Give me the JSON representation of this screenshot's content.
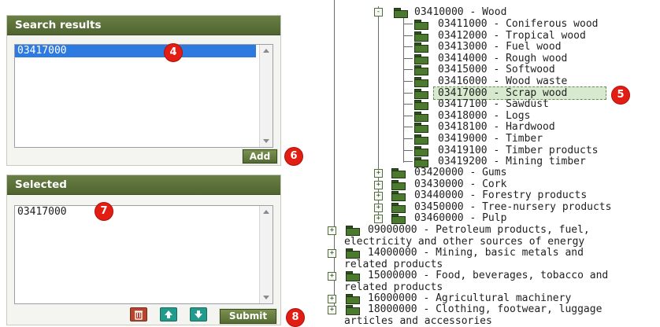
{
  "search_results": {
    "title": "Search results",
    "items": [
      "03417000"
    ],
    "add_label": "Add"
  },
  "selected": {
    "title": "Selected",
    "items": [
      "03417000"
    ],
    "submit_label": "Submit"
  },
  "markers": [
    "4",
    "5",
    "6",
    "7",
    "8"
  ],
  "tree": {
    "wood": "03410000 - Wood",
    "wood_children": [
      "03411000 - Coniferous wood",
      "03412000 - Tropical wood",
      "03413000 - Fuel wood",
      "03414000 - Rough wood",
      "03415000 - Softwood",
      "03416000 - Wood waste",
      "03417000 - Scrap wood",
      "03417100 - Sawdust",
      "03418000 - Logs",
      "03418100 - Hardwood",
      "03419000 - Timber",
      "03419100 - Timber products",
      "03419200 - Mining timber"
    ],
    "siblings": [
      "03420000 - Gums",
      "03430000 - Cork",
      "03440000 - Forestry products",
      "03450000 - Tree-nursery products",
      "03460000 - Pulp"
    ],
    "top_level": [
      {
        "line1": "09000000 - Petroleum products, fuel,",
        "line2": "electricity and other sources of energy"
      },
      {
        "line1": "14000000 - Mining, basic metals and",
        "line2": "related products"
      },
      {
        "line1": "15000000 - Food, beverages, tobacco and",
        "line2": "related products"
      },
      {
        "line1": "16000000 - Agricultural machinery",
        "line2": ""
      },
      {
        "line1": "18000000 - Clothing, footwear, luggage",
        "line2": "articles and accessories"
      }
    ]
  },
  "icons": {
    "delete": "trash-icon",
    "move_up": "arrow-up-icon",
    "move_down": "arrow-down-icon"
  },
  "colors": {
    "header_green": "#5a6f3a",
    "selection_blue": "#2d7be0",
    "marker_red": "#e21d14",
    "delete_button": "#b5452e",
    "move_button": "#239b8c"
  }
}
